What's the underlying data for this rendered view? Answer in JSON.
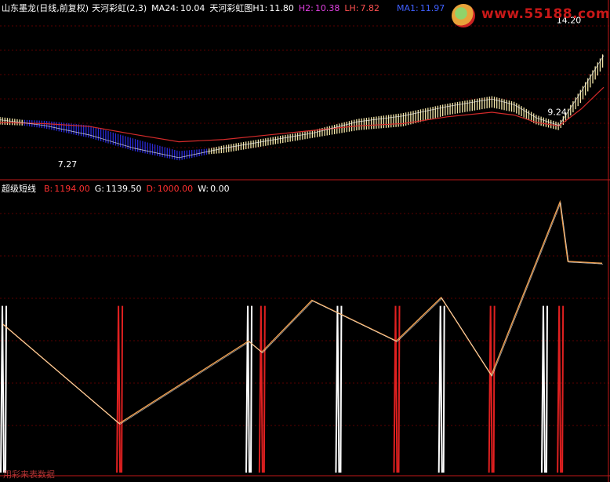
{
  "top_panel": {
    "title": "山东墨龙(日线,前复权)",
    "indicator_name": "天河彩虹(2,3)",
    "ma24": {
      "label": "MA24:",
      "value": "10.04"
    },
    "indicator2": "天河彩虹图",
    "h1": {
      "label": "H1:",
      "value": "11.80"
    },
    "h2": {
      "label": "H2:",
      "value": "10.38"
    },
    "lh": {
      "label": "LH:",
      "value": "7.82"
    },
    "ma1": {
      "label": "MA1:",
      "value": "11.97"
    },
    "high_label": "14.20",
    "low_label": "7.27",
    "mid_label": "9.24"
  },
  "bottom_panel": {
    "title": "超级短线",
    "b": {
      "label": "B:",
      "value": "1194.00"
    },
    "g": {
      "label": "G:",
      "value": "1139.50"
    },
    "d": {
      "label": "D:",
      "value": "1000.00"
    },
    "w": {
      "label": "W:",
      "value": "0.00"
    },
    "watermark": "用彩来表数据"
  },
  "watermark": {
    "site": "www.55188.com"
  },
  "colors": {
    "background": "#000000",
    "up": "#f3e6a8",
    "down": "#2a2ad8",
    "ma": "#d42a2a",
    "buy": "#e02020",
    "sell": "#ffffff",
    "line": "#f0a050"
  },
  "chart_data": [
    {
      "type": "line",
      "title": "山东墨龙(日线,前复权) 天河彩虹(2,3)",
      "x": [
        0,
        10,
        20,
        30,
        40,
        50,
        60,
        70,
        80,
        90,
        100,
        110,
        115,
        120,
        125,
        130,
        135
      ],
      "series": [
        {
          "name": "MA24",
          "values": [
            9.4,
            9.3,
            9.05,
            8.35,
            7.7,
            7.9,
            8.3,
            8.7,
            9.1,
            9.3,
            9.9,
            10.3,
            10.05,
            9.4,
            9.1,
            10.6,
            12.5
          ]
        },
        {
          "name": "MA1",
          "values": [
            9.5,
            9.2,
            8.7,
            8.0,
            7.5,
            8.0,
            8.4,
            8.8,
            9.4,
            9.7,
            10.2,
            10.6,
            10.3,
            9.6,
            9.2,
            11.0,
            12.9
          ]
        }
      ],
      "annotations": [
        "14.20",
        "7.27",
        "9.24"
      ]
    },
    {
      "type": "line",
      "title": "超级短线",
      "x": [
        0,
        44,
        93,
        98,
        117,
        149,
        166,
        185,
        211,
        214,
        227
      ],
      "series": [
        {
          "name": "W",
          "values": [
            1160,
            1053,
            1142,
            1130,
            1186,
            1142,
            1189,
            1105,
            1292,
            1228,
            1226
          ]
        }
      ],
      "buy_points": [
        44,
        98,
        149,
        185,
        211
      ],
      "sell_points": [
        0,
        93,
        127,
        166,
        205
      ]
    }
  ]
}
